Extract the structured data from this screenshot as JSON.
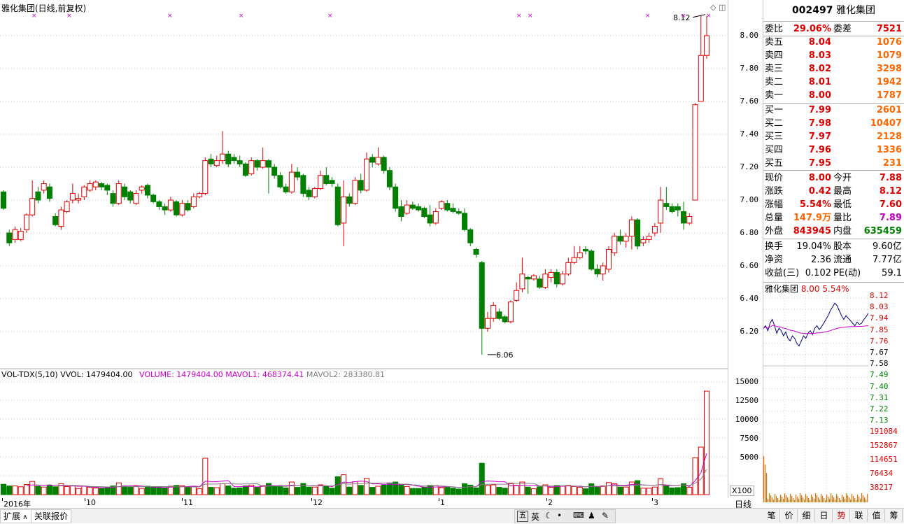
{
  "chart": {
    "title": "雅化集团(日线,前复权)",
    "price_ticks": [
      "8.00",
      "7.80",
      "7.60",
      "7.40",
      "7.20",
      "7.00",
      "6.80",
      "6.60",
      "6.40",
      "6.20"
    ],
    "high_label": "8.12",
    "low_label": "6.06",
    "volume_legend": {
      "name": "VOL-TDX(5,10)",
      "vvol": "VVOL: 1479404.00",
      "volume": "VOLUME: 1479404.00",
      "mavol1": "MAVOL1: 468374.41",
      "mavol2": "MAVOL2: 283380.81"
    },
    "volume_ticks": [
      "15000",
      "12500",
      "10000",
      "7500",
      "5000"
    ],
    "volume_unit": "X100",
    "date_labels": [
      "2016年",
      "10",
      "11",
      "12",
      "1",
      "2",
      "3"
    ],
    "period": "日线",
    "colors": {
      "up": "#e00000",
      "down": "#008000",
      "mavol1": "#cc00cc",
      "mavol2": "#808080",
      "grid": "#c8c8c8"
    }
  },
  "chart_data": {
    "type": "candlestick",
    "ylim": [
      6.0,
      8.2
    ],
    "candles": [
      [
        7.05,
        6.95,
        7.06,
        6.94
      ],
      [
        6.8,
        6.74,
        6.82,
        6.72
      ],
      [
        6.76,
        6.82,
        6.84,
        6.74
      ],
      [
        6.76,
        6.81,
        6.83,
        6.75
      ],
      [
        6.82,
        6.91,
        6.92,
        6.8
      ],
      [
        6.91,
        7.01,
        7.12,
        6.9
      ],
      [
        7.05,
        7.0,
        7.08,
        6.98
      ],
      [
        7.06,
        7.1,
        7.12,
        7.04
      ],
      [
        7.08,
        7.01,
        7.1,
        6.99
      ],
      [
        6.9,
        6.85,
        6.92,
        6.84
      ],
      [
        6.84,
        6.94,
        6.96,
        6.82
      ],
      [
        6.93,
        6.99,
        7.0,
        6.92
      ],
      [
        7.0,
        7.04,
        7.1,
        6.98
      ],
      [
        7.0,
        7.01,
        7.04,
        6.98
      ],
      [
        7.02,
        7.08,
        7.09,
        7.0
      ],
      [
        7.06,
        7.1,
        7.12,
        7.05
      ],
      [
        7.08,
        7.11,
        7.12,
        7.06
      ],
      [
        7.1,
        7.08,
        7.11,
        7.06
      ],
      [
        7.09,
        7.06,
        7.1,
        7.03
      ],
      [
        7.04,
        6.98,
        7.06,
        6.96
      ],
      [
        6.98,
        7.1,
        7.12,
        6.97
      ],
      [
        7.08,
        7.02,
        7.1,
        7.0
      ],
      [
        7.05,
        7.0,
        7.06,
        6.98
      ],
      [
        6.98,
        7.04,
        7.06,
        6.97
      ],
      [
        7.06,
        7.08,
        7.09,
        7.04
      ],
      [
        7.09,
        7.03,
        7.1,
        7.01
      ],
      [
        7.03,
        6.99,
        7.04,
        6.98
      ],
      [
        6.99,
        6.96,
        7.0,
        6.94
      ],
      [
        6.96,
        6.94,
        6.98,
        6.91
      ],
      [
        6.94,
        7.0,
        7.02,
        6.93
      ],
      [
        6.99,
        6.91,
        7.0,
        6.9
      ],
      [
        6.91,
        6.98,
        7.0,
        6.9
      ],
      [
        6.98,
        6.94,
        7.0,
        6.93
      ],
      [
        6.96,
        7.02,
        7.04,
        6.95
      ],
      [
        7.02,
        7.04,
        7.05,
        7.01
      ],
      [
        7.04,
        7.24,
        7.26,
        7.03
      ],
      [
        7.25,
        7.22,
        7.28,
        7.2
      ],
      [
        7.21,
        7.24,
        7.27,
        7.2
      ],
      [
        7.24,
        7.28,
        7.42,
        7.22
      ],
      [
        7.28,
        7.22,
        7.3,
        7.2
      ],
      [
        7.26,
        7.24,
        7.28,
        7.22
      ],
      [
        7.24,
        7.22,
        7.27,
        7.2
      ],
      [
        7.22,
        7.15,
        7.23,
        7.14
      ],
      [
        7.16,
        7.24,
        7.26,
        7.15
      ],
      [
        7.24,
        7.2,
        7.25,
        7.18
      ],
      [
        7.2,
        7.24,
        7.32,
        7.19
      ],
      [
        7.24,
        7.2,
        7.25,
        7.04
      ],
      [
        7.2,
        7.15,
        7.22,
        7.13
      ],
      [
        7.15,
        7.08,
        7.17,
        7.07
      ],
      [
        7.08,
        7.05,
        7.1,
        7.04
      ],
      [
        7.05,
        7.17,
        7.22,
        7.04
      ],
      [
        7.17,
        7.14,
        7.2,
        7.12
      ],
      [
        7.15,
        7.04,
        7.16,
        7.02
      ],
      [
        7.06,
        7.02,
        7.08,
        7.0
      ],
      [
        7.02,
        7.07,
        7.08,
        7.01
      ],
      [
        7.07,
        7.15,
        7.18,
        7.06
      ],
      [
        7.15,
        7.1,
        7.2,
        7.09
      ],
      [
        7.12,
        7.1,
        7.14,
        7.08
      ],
      [
        7.08,
        6.85,
        7.1,
        6.84
      ],
      [
        6.86,
        7.02,
        7.12,
        6.72
      ],
      [
        7.02,
        6.98,
        7.04,
        6.96
      ],
      [
        6.98,
        7.12,
        7.14,
        6.97
      ],
      [
        7.12,
        7.06,
        7.16,
        7.04
      ],
      [
        7.06,
        7.25,
        7.29,
        7.05
      ],
      [
        7.26,
        7.23,
        7.28,
        7.2
      ],
      [
        7.22,
        7.26,
        7.32,
        7.21
      ],
      [
        7.26,
        7.18,
        7.27,
        7.16
      ],
      [
        7.18,
        7.08,
        7.2,
        7.06
      ],
      [
        7.08,
        6.95,
        7.1,
        6.93
      ],
      [
        6.96,
        6.9,
        7.0,
        6.87
      ],
      [
        6.92,
        6.97,
        7.0,
        6.91
      ],
      [
        6.97,
        6.95,
        6.99,
        6.94
      ],
      [
        6.96,
        6.94,
        6.98,
        6.93
      ],
      [
        6.95,
        6.9,
        6.96,
        6.89
      ],
      [
        6.91,
        6.86,
        6.97,
        6.84
      ],
      [
        6.86,
        6.93,
        6.95,
        6.85
      ],
      [
        6.95,
        6.99,
        7.0,
        6.94
      ],
      [
        6.98,
        6.94,
        7.0,
        6.93
      ],
      [
        6.95,
        6.93,
        6.98,
        6.92
      ],
      [
        6.93,
        6.92,
        6.95,
        6.91
      ],
      [
        6.92,
        6.82,
        6.95,
        6.81
      ],
      [
        6.82,
        6.74,
        6.83,
        6.72
      ],
      [
        6.7,
        6.67,
        6.71,
        6.65
      ],
      [
        6.62,
        6.22,
        6.63,
        6.06
      ],
      [
        6.22,
        6.28,
        6.32,
        6.2
      ],
      [
        6.28,
        6.36,
        6.38,
        6.26
      ],
      [
        6.32,
        6.28,
        6.34,
        6.27
      ],
      [
        6.29,
        6.26,
        6.3,
        6.25
      ],
      [
        6.26,
        6.38,
        6.39,
        6.25
      ],
      [
        6.39,
        6.45,
        6.5,
        6.38
      ],
      [
        6.46,
        6.55,
        6.65,
        6.44
      ],
      [
        6.53,
        6.52,
        6.54,
        6.43
      ],
      [
        6.52,
        6.54,
        6.55,
        6.51
      ],
      [
        6.52,
        6.47,
        6.54,
        6.46
      ],
      [
        6.47,
        6.55,
        6.58,
        6.46
      ],
      [
        6.53,
        6.56,
        6.58,
        6.5
      ],
      [
        6.56,
        6.49,
        6.58,
        6.47
      ],
      [
        6.49,
        6.55,
        6.57,
        6.48
      ],
      [
        6.55,
        6.62,
        6.65,
        6.54
      ],
      [
        6.62,
        6.65,
        6.72,
        6.61
      ],
      [
        6.65,
        6.68,
        6.72,
        6.64
      ],
      [
        6.7,
        6.69,
        6.72,
        6.67
      ],
      [
        6.69,
        6.58,
        6.7,
        6.57
      ],
      [
        6.58,
        6.55,
        6.61,
        6.53
      ],
      [
        6.55,
        6.6,
        6.62,
        6.51
      ],
      [
        6.58,
        6.7,
        6.72,
        6.56
      ],
      [
        6.68,
        6.78,
        6.8,
        6.66
      ],
      [
        6.78,
        6.75,
        6.82,
        6.73
      ],
      [
        6.75,
        6.78,
        6.8,
        6.71
      ],
      [
        6.78,
        6.88,
        6.9,
        6.7
      ],
      [
        6.88,
        6.72,
        6.89,
        6.7
      ],
      [
        6.74,
        6.76,
        6.78,
        6.72
      ],
      [
        6.76,
        6.78,
        6.8,
        6.74
      ],
      [
        6.8,
        6.84,
        6.86,
        6.78
      ],
      [
        6.86,
        7.0,
        7.08,
        6.8
      ],
      [
        6.98,
        6.96,
        7.08,
        6.94
      ],
      [
        6.96,
        6.93,
        6.98,
        6.92
      ],
      [
        6.96,
        6.94,
        6.98,
        6.9
      ],
      [
        6.93,
        6.86,
        6.99,
        6.82
      ],
      [
        6.86,
        6.9,
        6.92,
        6.85
      ],
      [
        7.0,
        7.58,
        7.59,
        7.0
      ],
      [
        7.6,
        7.88,
        8.12,
        7.6
      ],
      [
        7.88,
        8.0,
        8.12,
        7.86
      ]
    ],
    "volume_ylim": [
      0,
      16000
    ]
  },
  "quote": {
    "code": "002497",
    "name": "雅化集团",
    "weibi_label": "委比",
    "weibi": "29.06%",
    "weicha_label": "委差",
    "weicha": "7521",
    "asks": [
      {
        "label": "卖五",
        "price": "8.04",
        "vol": "1076"
      },
      {
        "label": "卖四",
        "price": "8.03",
        "vol": "1079"
      },
      {
        "label": "卖三",
        "price": "8.02",
        "vol": "3298"
      },
      {
        "label": "卖二",
        "price": "8.01",
        "vol": "1942"
      },
      {
        "label": "卖一",
        "price": "8.00",
        "vol": "1787"
      }
    ],
    "bids": [
      {
        "label": "买一",
        "price": "7.99",
        "vol": "2601"
      },
      {
        "label": "买二",
        "price": "7.98",
        "vol": "10407"
      },
      {
        "label": "买三",
        "price": "7.97",
        "vol": "2128"
      },
      {
        "label": "买四",
        "price": "7.96",
        "vol": "1336"
      },
      {
        "label": "买五",
        "price": "7.95",
        "vol": "231"
      }
    ],
    "stats": [
      {
        "l1": "现价",
        "v1": "8.00",
        "c1": "red",
        "l2": "今开",
        "v2": "7.88",
        "c2": "red"
      },
      {
        "l1": "涨跌",
        "v1": "0.42",
        "c1": "red",
        "l2": "最高",
        "v2": "8.12",
        "c2": "red"
      },
      {
        "l1": "涨幅",
        "v1": "5.54%",
        "c1": "red",
        "l2": "最低",
        "v2": "7.60",
        "c2": "red"
      },
      {
        "l1": "总量",
        "v1": "147.9万",
        "c1": "org",
        "l2": "量比",
        "v2": "7.89",
        "c2": "mag"
      },
      {
        "l1": "外盘",
        "v1": "843945",
        "c1": "red",
        "l2": "内盘",
        "v2": "635459",
        "c2": "grn"
      }
    ],
    "info": [
      {
        "l1": "换手",
        "v1": "19.04%",
        "l2": "股本",
        "v2": "9.60亿"
      },
      {
        "l1": "净资",
        "v1": "2.36",
        "l2": "流通",
        "v2": "7.77亿"
      },
      {
        "l1": "收益(三)",
        "v1": "0.102",
        "l2": "PE(动)",
        "v2": "59.1"
      }
    ]
  },
  "mini": {
    "title": "雅化集团",
    "price": "8.00",
    "pct": "5.54%",
    "price_ticks_up": [
      "8.12",
      "8.03",
      "7.94",
      "7.85"
    ],
    "price_ticks_mid": [
      "7.76",
      "7.67",
      "7.58"
    ],
    "price_ticks_down": [
      "7.49",
      "7.40",
      "7.31",
      "7.22",
      "7.13"
    ],
    "vol_ticks": [
      "191084",
      "152867",
      "114651",
      "76434",
      "38217"
    ]
  },
  "bottom": {
    "tab1": "扩展",
    "tab2": "关联报价",
    "ime_label": "英"
  },
  "right_tabs": [
    "笔",
    "价",
    "细",
    "日",
    "势",
    "联",
    "值",
    "筹"
  ]
}
